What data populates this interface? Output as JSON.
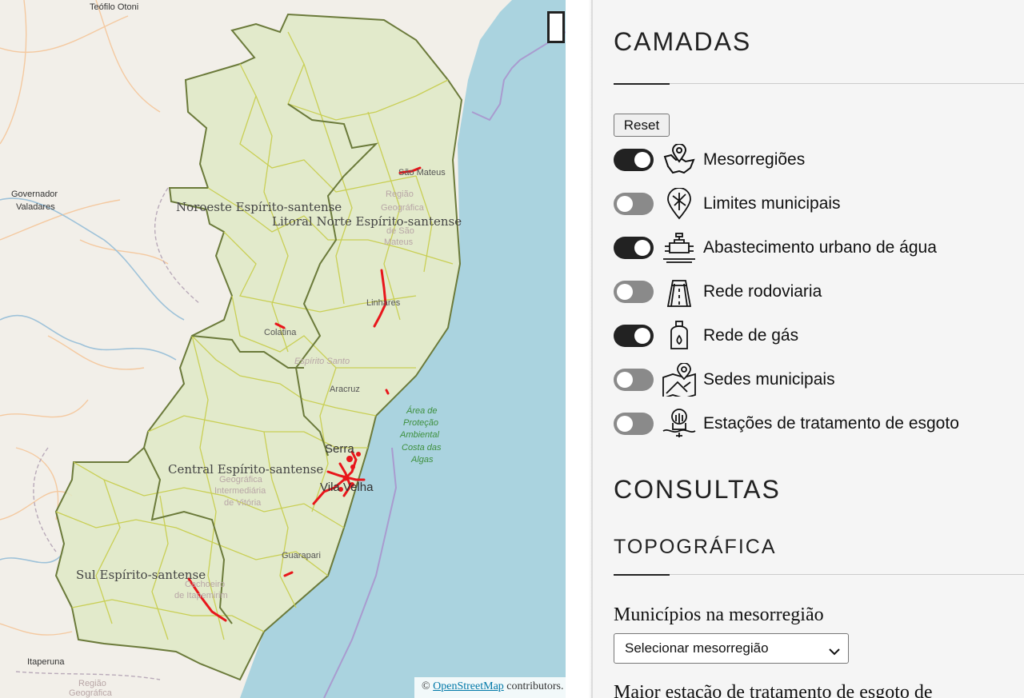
{
  "map": {
    "labels": {
      "teofilo": "Teófilo Otoni",
      "governador1": "Governador",
      "governador2": "Valadares",
      "itaperuna": "Itaperuna",
      "regiao1": "Região",
      "regiao2": "Geográfica",
      "sao_mateus": "São Mateus",
      "regiao_sm1": "Região",
      "regiao_sm2": "Geográfica",
      "regiao_sm3": "de São",
      "regiao_sm4": "Mateus",
      "linhares": "Linhares",
      "colatina": "Colatina",
      "espirito_santo": "Espírito Santo",
      "aracruz": "Aracruz",
      "serra": "Serra",
      "vila_velha": "Vila Velha",
      "guarapari": "Guarapari",
      "cachoeiro1": "Cachoeiro",
      "cachoeiro2": "de Itapemirim",
      "intermed1": "Geográfica",
      "intermed2": "Intermediária",
      "intermed3": "de Vitória",
      "area1": "Área de",
      "area2": "Proteção",
      "area3": "Ambiental",
      "area4": "Costa das",
      "area5": "Algas"
    },
    "mesoregions": {
      "noroeste": "Noroeste Espírito-santense",
      "litoral_norte": "Litoral Norte Espírito-santense",
      "central": "Central Espírito-santense",
      "sul": "Sul Espírito-santense"
    },
    "attribution": {
      "prefix": "©",
      "link": "OpenStreetMap",
      "suffix": "contributors."
    },
    "colors": {
      "land": "#f2efe9",
      "sea": "#aad3df",
      "state_fill": "#dfe9c6",
      "municipal_border": "#c9cf55",
      "meso_border": "#6b7a3a",
      "water_network": "#e8161b"
    }
  },
  "panel": {
    "layers_title": "CAMADAS",
    "reset_label": "Reset",
    "layers": [
      {
        "label": "Mesorregiões",
        "on": true,
        "icon": "map-pin-icon"
      },
      {
        "label": "Limites municipais",
        "on": false,
        "icon": "location-pin-icon"
      },
      {
        "label": "Abastecimento urbano de água",
        "on": true,
        "icon": "water-pipe-icon"
      },
      {
        "label": "Rede rodoviaria",
        "on": false,
        "icon": "road-icon"
      },
      {
        "label": "Rede de gás",
        "on": true,
        "icon": "gas-cylinder-icon"
      },
      {
        "label": "Sedes municipais",
        "on": false,
        "icon": "folded-map-icon"
      },
      {
        "label": "Estações de tratamento de esgoto",
        "on": false,
        "icon": "sewage-treatment-icon"
      }
    ],
    "consultas_title": "CONSULTAS",
    "topo_title": "TOPOGRÁFICA",
    "municipios_label": "Municípios na mesorregião",
    "select_value": "Selecionar mesorregião",
    "maior_label": "Maior estação de tratamento de esgoto de"
  }
}
